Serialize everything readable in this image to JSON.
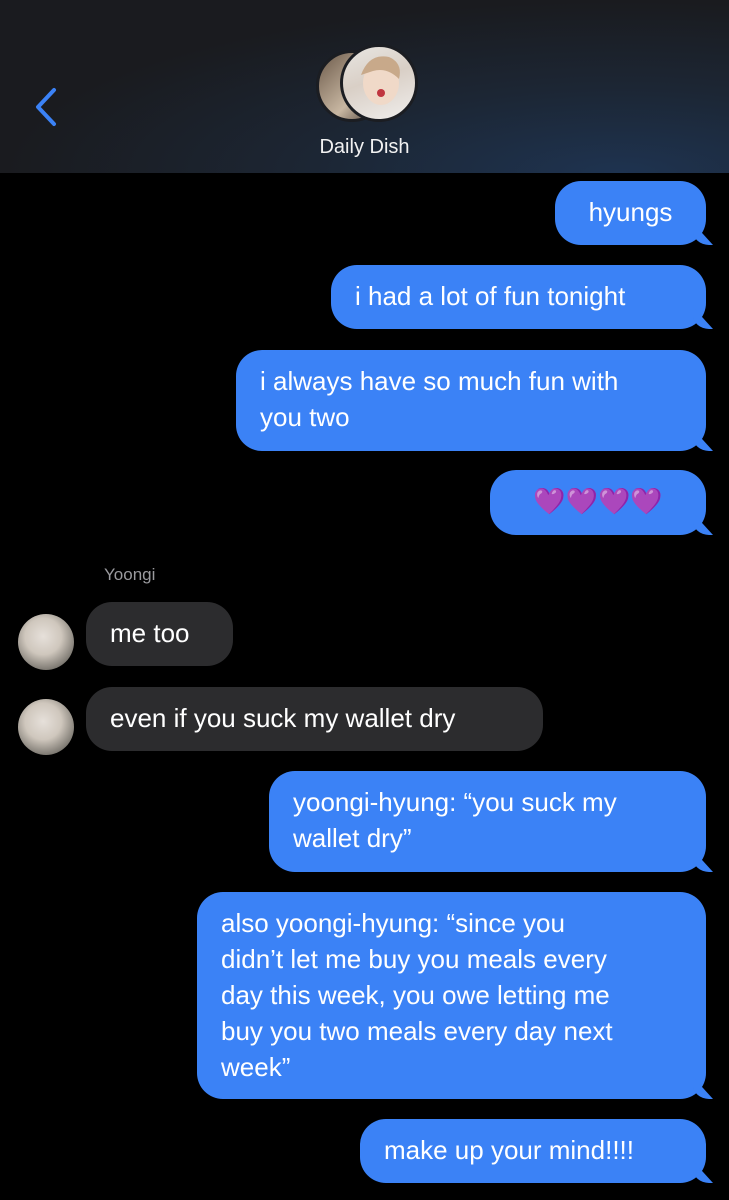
{
  "header": {
    "chat_title": "Daily Dish",
    "colors": {
      "accent": "#3b82f6"
    }
  },
  "messages": {
    "m1": "hyungs",
    "m2": "i had a lot of fun tonight",
    "m3_line1": "i always have so much fun with",
    "m3_line2": "you two",
    "m4": "💜💜💜💜",
    "sender_name": "Yoongi",
    "m5": "me too",
    "m6": "even if you suck my wallet dry",
    "m7_line1": "yoongi-hyung: “you suck my",
    "m7_line2": "wallet dry”",
    "m8_line1": "also yoongi-hyung: “since you",
    "m8_line2": "didn’t let me buy you meals every",
    "m8_line3": "day this week, you owe letting me",
    "m8_line4": "buy you two meals every day next",
    "m8_line5": "week”",
    "m9": "make up your mind!!!!"
  },
  "colors": {
    "outgoing": "#3b82f6",
    "incoming": "#2c2c2e",
    "heart": "#a855f7"
  }
}
